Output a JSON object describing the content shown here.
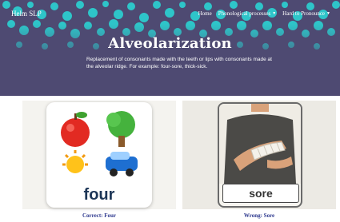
{
  "site": {
    "logo": "Helm SLP"
  },
  "nav": [
    {
      "label": "Home"
    },
    {
      "label": "Phonological processes"
    },
    {
      "label": "Hard to Pronounce"
    }
  ],
  "hero": {
    "title": "Alveolarization",
    "description": "Replacement of consonants made with the teeth or lips with consonants made at the alveolar ridge. For example: four-sore, thick-sick."
  },
  "cards": [
    {
      "word": "four",
      "caption": "Correct: Four"
    },
    {
      "word": "sore",
      "caption": "Wrong: Sore"
    }
  ],
  "colors": {
    "hero_bg": "#4e4a72",
    "dots": "#2ec5c9",
    "caption": "#2f3a8f"
  }
}
